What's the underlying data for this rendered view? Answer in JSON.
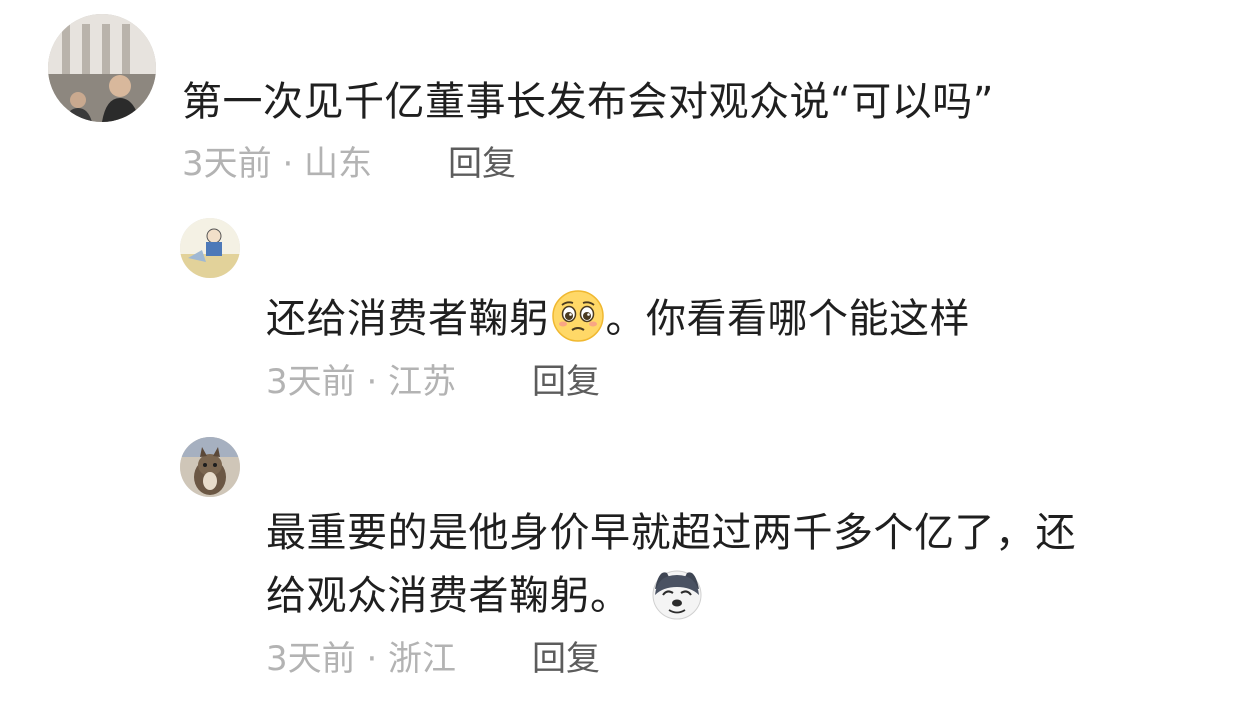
{
  "comments": [
    {
      "text": "第一次见千亿董事长发布会对观众说“可以吗”",
      "meta": "3天前 · 山东",
      "reply_label": "回复"
    },
    {
      "text_before": "还给消费者鞠躬",
      "emoji_1": "pleading-face-emoji",
      "text_after": "。你看看哪个能这样",
      "meta": "3天前 · 江苏",
      "reply_label": "回复"
    },
    {
      "line_1": "最重要的是他身价早就超过两千多个亿了，还",
      "line_2": "给观众消费者鞠躬。",
      "emoji_1": "doge-emoji",
      "meta": "3天前 · 浙江",
      "reply_label": "回复"
    }
  ],
  "colors": {
    "text": "#1f1f1f",
    "meta": "#b3b3b3",
    "reply": "#5c5c5c"
  }
}
